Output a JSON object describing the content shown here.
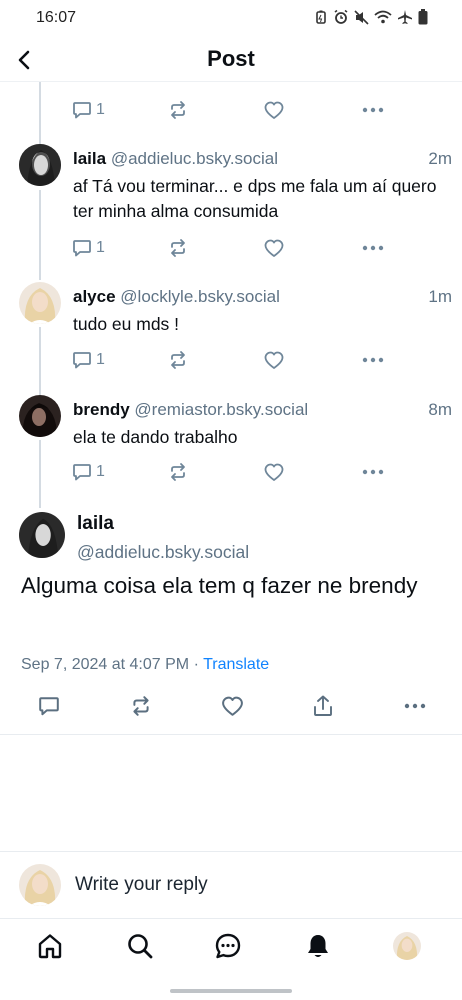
{
  "status_bar": {
    "time": "16:07"
  },
  "header": {
    "title": "Post"
  },
  "top_post": {
    "reply_count": "1"
  },
  "replies": [
    {
      "name": "laila",
      "handle": "@addieluc.bsky.social",
      "time": "2m",
      "text": "af Tá vou terminar...  e dps me fala um aí quero ter minha alma consumida",
      "reply_count": "1"
    },
    {
      "name": "alyce",
      "handle": "@locklyle.bsky.social",
      "time": "1m",
      "text": "tudo eu mds !",
      "reply_count": "1"
    },
    {
      "name": "brendy",
      "handle": "@remiastor.bsky.social",
      "time": "8m",
      "text": "ela te dando trabalho",
      "reply_count": "1"
    }
  ],
  "main_post": {
    "name": "laila",
    "handle": "@addieluc.bsky.social",
    "text": "Alguma coisa ela tem q fazer ne brendy",
    "date": "Sep 7, 2024 at 4:07 PM",
    "separator": "·",
    "translate": "Translate"
  },
  "reply_bar": {
    "placeholder": "Write your reply"
  },
  "icons": {
    "back": "chevron-left-icon",
    "reply": "speech-bubble-icon",
    "repost": "repost-icon",
    "like": "heart-icon",
    "more": "ellipsis-icon",
    "share": "share-icon",
    "home": "home-icon",
    "search": "search-icon",
    "chat": "chat-icon",
    "notifications": "bell-icon"
  },
  "colors": {
    "accent": "#1083fe",
    "muted": "#6f8699",
    "text": "#0b0f14"
  }
}
